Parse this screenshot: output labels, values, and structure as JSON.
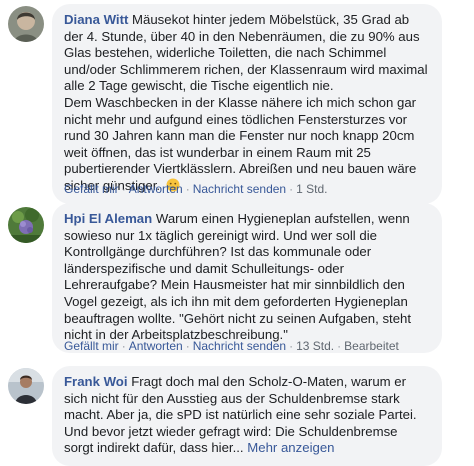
{
  "comments": [
    {
      "author": "Diana Witt",
      "text": "Mäusekot hinter jedem Möbelstück, 35 Grad ab der 4. Stunde, über 40 in den Nebenräumen, die zu 90% aus Glas bestehen, widerliche Toiletten, die nach Schimmel und/oder Schlimmerem richen, der Klassenraum wird maximal alle 2 Tage gewischt, die Tische eigentlich nie.\nDem Waschbecken in der Klasse nähere ich mich schon gar nicht mehr und aufgund eines tödlichen Fenstersturzes vor rund 30 Jahren kann man die Fenster nur noch knapp 20cm weit öffnen, das ist wunderbar in einem Raum mit 25 pubertierender Viertklässlern. Abreißen und neu bauen wäre sicher günstiger.",
      "emoji": "sad-face",
      "actions": {
        "like": "Gefällt mir",
        "reply": "Antworten",
        "message": "Nachricht senden",
        "time": "1 Std."
      }
    },
    {
      "author": "Hpi El Aleman",
      "text": "Warum einen Hygieneplan aufstellen, wenn sowieso nur 1x täglich gereinigt wird. Und wer soll die Kontrollgänge durchführen? Ist das kommunale oder länderspezifische und damit Schulleitungs- oder Lehreraufgabe? Mein Hausmeister hat mir sinnbildlich den Vogel gezeigt, als ich ihn mit dem geforderten Hygieneplan beauftragen wollte. \"Gehört nicht zu seinen Aufgaben, steht nicht in der Arbeitsplatzbeschreibung.\"",
      "actions": {
        "like": "Gefällt mir",
        "reply": "Antworten",
        "message": "Nachricht senden",
        "time": "13 Std.",
        "edited": "Bearbeitet"
      }
    },
    {
      "author": "Frank Woi",
      "text": "Fragt doch mal den Scholz-O-Maten, warum er sich nicht für den Ausstieg aus der Schuldenbremse stark macht. Aber ja, die sPD ist natürlich eine sehr soziale Partei. Und bevor jetzt wieder gefragt wird: Die Schuldenbremse sorgt indirekt dafür, dass hier...",
      "more": "Mehr anzeigen"
    }
  ],
  "colors": {
    "author": "#385898",
    "bubble": "#f2f3f5",
    "meta": "#606770"
  }
}
